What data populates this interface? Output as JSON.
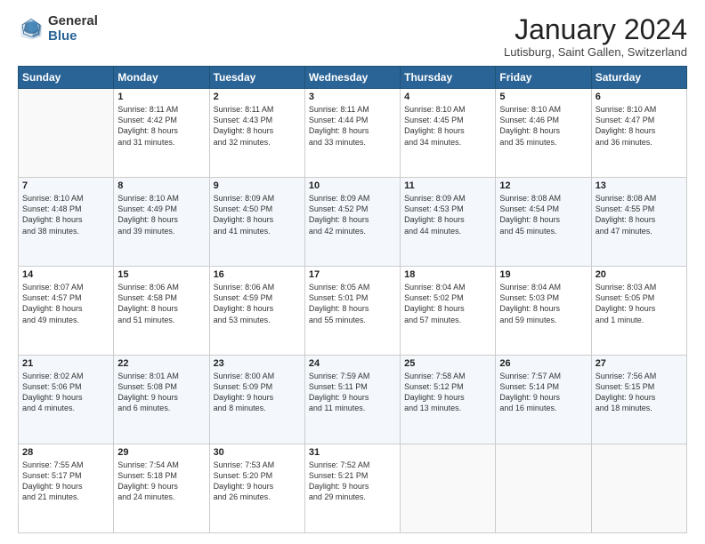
{
  "header": {
    "logo_general": "General",
    "logo_blue": "Blue",
    "month": "January 2024",
    "location": "Lutisburg, Saint Gallen, Switzerland"
  },
  "weekdays": [
    "Sunday",
    "Monday",
    "Tuesday",
    "Wednesday",
    "Thursday",
    "Friday",
    "Saturday"
  ],
  "weeks": [
    [
      {
        "day": "",
        "info": ""
      },
      {
        "day": "1",
        "info": "Sunrise: 8:11 AM\nSunset: 4:42 PM\nDaylight: 8 hours\nand 31 minutes."
      },
      {
        "day": "2",
        "info": "Sunrise: 8:11 AM\nSunset: 4:43 PM\nDaylight: 8 hours\nand 32 minutes."
      },
      {
        "day": "3",
        "info": "Sunrise: 8:11 AM\nSunset: 4:44 PM\nDaylight: 8 hours\nand 33 minutes."
      },
      {
        "day": "4",
        "info": "Sunrise: 8:10 AM\nSunset: 4:45 PM\nDaylight: 8 hours\nand 34 minutes."
      },
      {
        "day": "5",
        "info": "Sunrise: 8:10 AM\nSunset: 4:46 PM\nDaylight: 8 hours\nand 35 minutes."
      },
      {
        "day": "6",
        "info": "Sunrise: 8:10 AM\nSunset: 4:47 PM\nDaylight: 8 hours\nand 36 minutes."
      }
    ],
    [
      {
        "day": "7",
        "info": "Sunrise: 8:10 AM\nSunset: 4:48 PM\nDaylight: 8 hours\nand 38 minutes."
      },
      {
        "day": "8",
        "info": "Sunrise: 8:10 AM\nSunset: 4:49 PM\nDaylight: 8 hours\nand 39 minutes."
      },
      {
        "day": "9",
        "info": "Sunrise: 8:09 AM\nSunset: 4:50 PM\nDaylight: 8 hours\nand 41 minutes."
      },
      {
        "day": "10",
        "info": "Sunrise: 8:09 AM\nSunset: 4:52 PM\nDaylight: 8 hours\nand 42 minutes."
      },
      {
        "day": "11",
        "info": "Sunrise: 8:09 AM\nSunset: 4:53 PM\nDaylight: 8 hours\nand 44 minutes."
      },
      {
        "day": "12",
        "info": "Sunrise: 8:08 AM\nSunset: 4:54 PM\nDaylight: 8 hours\nand 45 minutes."
      },
      {
        "day": "13",
        "info": "Sunrise: 8:08 AM\nSunset: 4:55 PM\nDaylight: 8 hours\nand 47 minutes."
      }
    ],
    [
      {
        "day": "14",
        "info": "Sunrise: 8:07 AM\nSunset: 4:57 PM\nDaylight: 8 hours\nand 49 minutes."
      },
      {
        "day": "15",
        "info": "Sunrise: 8:06 AM\nSunset: 4:58 PM\nDaylight: 8 hours\nand 51 minutes."
      },
      {
        "day": "16",
        "info": "Sunrise: 8:06 AM\nSunset: 4:59 PM\nDaylight: 8 hours\nand 53 minutes."
      },
      {
        "day": "17",
        "info": "Sunrise: 8:05 AM\nSunset: 5:01 PM\nDaylight: 8 hours\nand 55 minutes."
      },
      {
        "day": "18",
        "info": "Sunrise: 8:04 AM\nSunset: 5:02 PM\nDaylight: 8 hours\nand 57 minutes."
      },
      {
        "day": "19",
        "info": "Sunrise: 8:04 AM\nSunset: 5:03 PM\nDaylight: 8 hours\nand 59 minutes."
      },
      {
        "day": "20",
        "info": "Sunrise: 8:03 AM\nSunset: 5:05 PM\nDaylight: 9 hours\nand 1 minute."
      }
    ],
    [
      {
        "day": "21",
        "info": "Sunrise: 8:02 AM\nSunset: 5:06 PM\nDaylight: 9 hours\nand 4 minutes."
      },
      {
        "day": "22",
        "info": "Sunrise: 8:01 AM\nSunset: 5:08 PM\nDaylight: 9 hours\nand 6 minutes."
      },
      {
        "day": "23",
        "info": "Sunrise: 8:00 AM\nSunset: 5:09 PM\nDaylight: 9 hours\nand 8 minutes."
      },
      {
        "day": "24",
        "info": "Sunrise: 7:59 AM\nSunset: 5:11 PM\nDaylight: 9 hours\nand 11 minutes."
      },
      {
        "day": "25",
        "info": "Sunrise: 7:58 AM\nSunset: 5:12 PM\nDaylight: 9 hours\nand 13 minutes."
      },
      {
        "day": "26",
        "info": "Sunrise: 7:57 AM\nSunset: 5:14 PM\nDaylight: 9 hours\nand 16 minutes."
      },
      {
        "day": "27",
        "info": "Sunrise: 7:56 AM\nSunset: 5:15 PM\nDaylight: 9 hours\nand 18 minutes."
      }
    ],
    [
      {
        "day": "28",
        "info": "Sunrise: 7:55 AM\nSunset: 5:17 PM\nDaylight: 9 hours\nand 21 minutes."
      },
      {
        "day": "29",
        "info": "Sunrise: 7:54 AM\nSunset: 5:18 PM\nDaylight: 9 hours\nand 24 minutes."
      },
      {
        "day": "30",
        "info": "Sunrise: 7:53 AM\nSunset: 5:20 PM\nDaylight: 9 hours\nand 26 minutes."
      },
      {
        "day": "31",
        "info": "Sunrise: 7:52 AM\nSunset: 5:21 PM\nDaylight: 9 hours\nand 29 minutes."
      },
      {
        "day": "",
        "info": ""
      },
      {
        "day": "",
        "info": ""
      },
      {
        "day": "",
        "info": ""
      }
    ]
  ]
}
